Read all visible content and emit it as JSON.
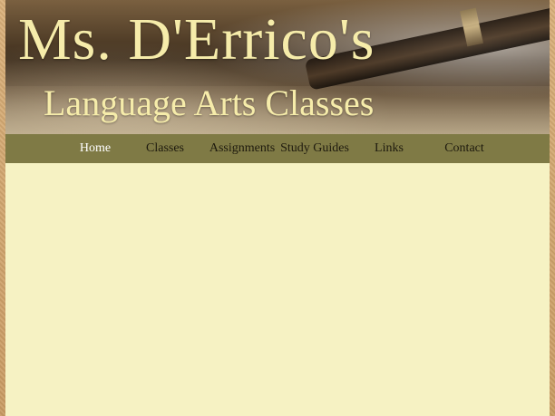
{
  "header": {
    "title_line1": "Ms. D'Errico's",
    "title_line2": "Language Arts Classes"
  },
  "nav": {
    "items": [
      {
        "label": "Home",
        "active": true
      },
      {
        "label": "Classes",
        "active": false
      },
      {
        "label": "Assignments",
        "active": false
      },
      {
        "label": "Study Guides",
        "active": false
      },
      {
        "label": "Links",
        "active": false
      },
      {
        "label": "Contact",
        "active": false
      }
    ]
  },
  "colors": {
    "background": "#d9b07a",
    "content": "#f6f2c3",
    "navbar": "#7f7a45",
    "title_text": "#f6ecaa",
    "nav_active_text": "#ffffff"
  }
}
